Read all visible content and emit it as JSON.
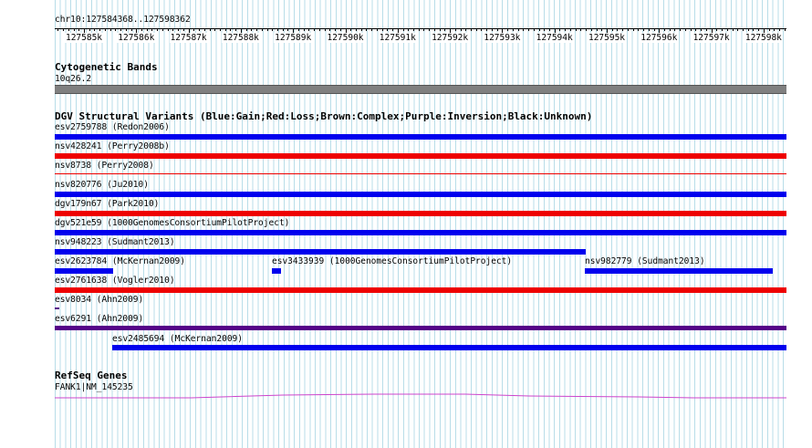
{
  "position": "chr10:127584368..127598362",
  "ruler_labels": [
    "127585k",
    "127586k",
    "127587k",
    "127588k",
    "127589k",
    "127590k",
    "127591k",
    "127592k",
    "127593k",
    "127594k",
    "127595k",
    "127596k",
    "127597k",
    "127598k"
  ],
  "tracks": {
    "cyto": {
      "title": "Cytogenetic Bands",
      "band": "10q26.2"
    },
    "dgv": {
      "title": "DGV Structural Variants (Blue:Gain;Red:Loss;Brown:Complex;Purple:Inversion;Black:Unknown)",
      "colors": {
        "gain": "#0000ee",
        "loss": "#ee0000",
        "inversion": "#550088"
      },
      "variants": [
        "esv2759788 (Redon2006)",
        "nsv428241 (Perry2008b)",
        "nsv8738 (Perry2008)",
        "nsv820776 (Ju2010)",
        "dgv179n67 (Park2010)",
        "dgv521e59 (1000GenomesConsortiumPilotProject)",
        "nsv948223 (Sudmant2013)",
        "esv2623784 (McKernan2009)",
        "esv3433939 (1000GenomesConsortiumPilotProject)",
        "nsv982779 (Sudmant2013)",
        "esv2761638 (Vogler2010)",
        "esv8034 (Ahn2009)",
        "esv6291 (Ahn2009)",
        "esv2485694 (McKernan2009)"
      ]
    },
    "refseq": {
      "title": "RefSeq Genes",
      "gene": "FANK1|NM_145235",
      "color": "#cc44cc"
    }
  }
}
